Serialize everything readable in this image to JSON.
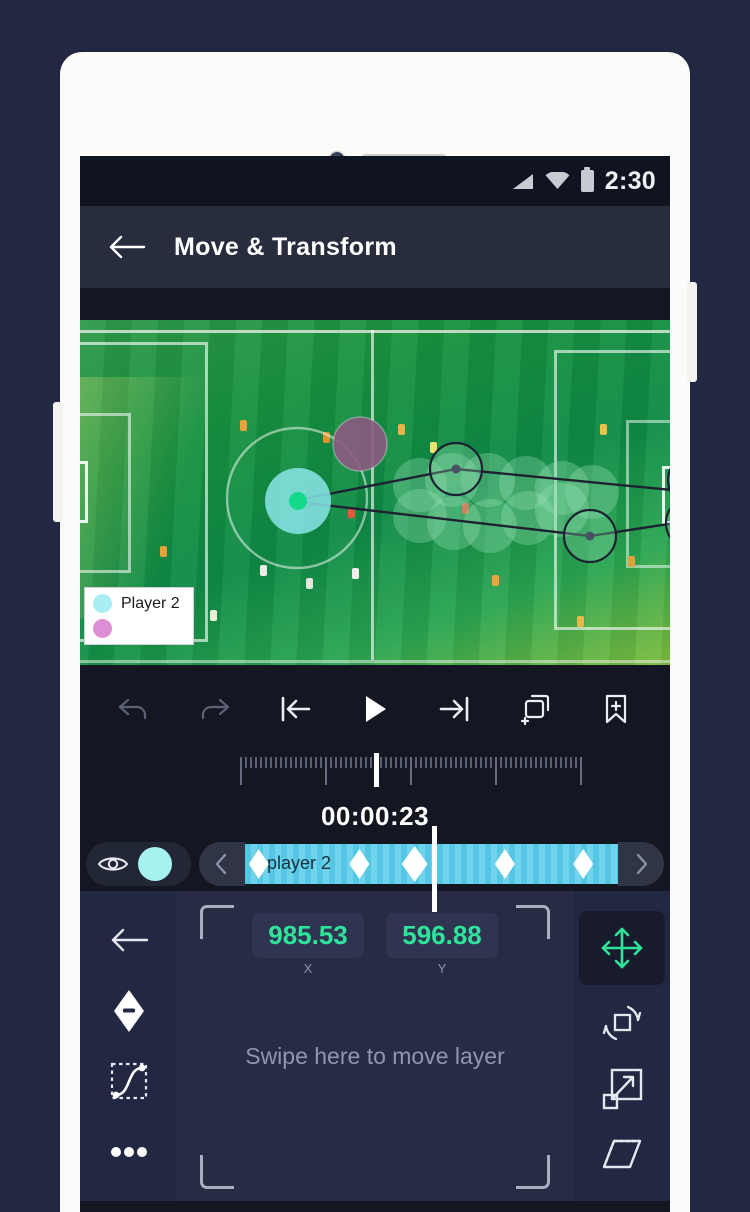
{
  "status_bar": {
    "time": "2:30",
    "icons": [
      "signal-icon",
      "wifi-icon",
      "battery-icon"
    ]
  },
  "app_bar": {
    "back_icon": "back-arrow-icon",
    "title": "Move & Transform"
  },
  "preview": {
    "legend": {
      "rows": [
        {
          "color": "#a8eef2",
          "label": "Player 2"
        },
        {
          "color": "#dd8ed4",
          "label": ""
        }
      ]
    },
    "selected_layer_color": "#8fe9ef",
    "path_accent": "#15d98a"
  },
  "transport": {
    "buttons": [
      {
        "name": "undo-button",
        "icon": "undo-icon"
      },
      {
        "name": "redo-button",
        "icon": "redo-icon"
      },
      {
        "name": "jump-to-start-button",
        "icon": "skip-to-start-icon"
      },
      {
        "name": "play-button",
        "icon": "play-icon"
      },
      {
        "name": "jump-to-end-button",
        "icon": "skip-to-end-icon"
      },
      {
        "name": "duplicate-layer-button",
        "icon": "duplicate-add-icon"
      },
      {
        "name": "bookmark-button",
        "icon": "bookmark-add-icon"
      }
    ]
  },
  "timeline": {
    "timecode": "00:00:23",
    "track": {
      "label": "player 2",
      "layer_color": "#a5f2f0",
      "visibility_icon": "eye-icon",
      "prev_icon": "chevron-left-icon",
      "next_icon": "chevron-right-icon",
      "keyframes": [
        {
          "position_pct": 1,
          "selected": false
        },
        {
          "position_pct": 28,
          "selected": false
        },
        {
          "position_pct": 42,
          "selected": true
        },
        {
          "position_pct": 67,
          "selected": false
        },
        {
          "position_pct": 88,
          "selected": false
        }
      ]
    }
  },
  "editor": {
    "left_rail": [
      {
        "name": "back-button",
        "icon": "back-arrow-icon"
      },
      {
        "name": "delete-keyframe-button",
        "icon": "keyframe-minus-icon"
      },
      {
        "name": "easing-curve-button",
        "icon": "bezier-curve-icon"
      },
      {
        "name": "more-options-button",
        "icon": "more-dots-icon"
      }
    ],
    "right_rail": [
      {
        "name": "move-tool-button",
        "icon": "move-arrows-icon",
        "active": true
      },
      {
        "name": "rotate-tool-button",
        "icon": "rotate-icon",
        "active": false
      },
      {
        "name": "scale-tool-button",
        "icon": "scale-icon",
        "active": false
      },
      {
        "name": "skew-tool-button",
        "icon": "skew-icon",
        "active": false
      }
    ],
    "fields": [
      {
        "name": "x-value-field",
        "value": "985.53",
        "label": "X"
      },
      {
        "name": "y-value-field",
        "value": "596.88",
        "label": "Y"
      }
    ],
    "hint": "Swipe here to move layer",
    "accent_color": "#2fe39a"
  }
}
